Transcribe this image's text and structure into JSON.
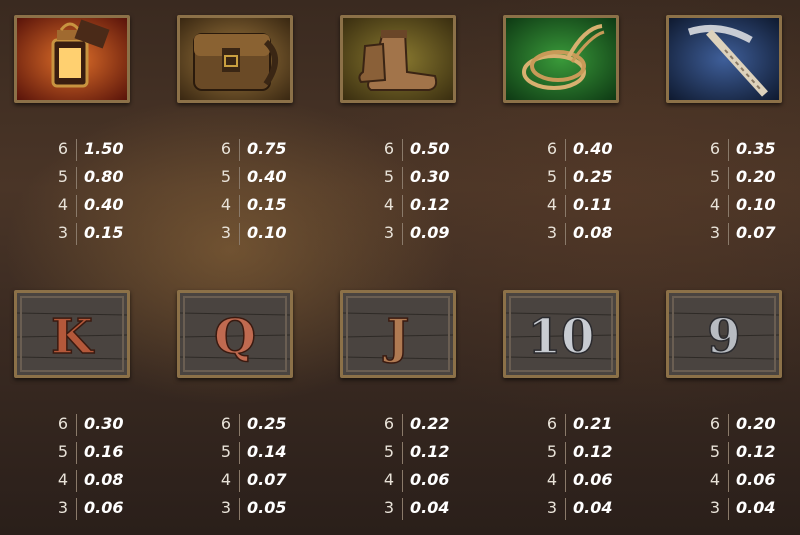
{
  "rows": [
    {
      "symbols": [
        {
          "name": "lantern",
          "icon": "lantern-icon",
          "pays": [
            {
              "count": "6",
              "value": "1.50"
            },
            {
              "count": "5",
              "value": "0.80"
            },
            {
              "count": "4",
              "value": "0.40"
            },
            {
              "count": "3",
              "value": "0.15"
            }
          ]
        },
        {
          "name": "backpack",
          "icon": "backpack-icon",
          "pays": [
            {
              "count": "6",
              "value": "0.75"
            },
            {
              "count": "5",
              "value": "0.40"
            },
            {
              "count": "4",
              "value": "0.15"
            },
            {
              "count": "3",
              "value": "0.10"
            }
          ]
        },
        {
          "name": "boots",
          "icon": "boots-icon",
          "pays": [
            {
              "count": "6",
              "value": "0.50"
            },
            {
              "count": "5",
              "value": "0.30"
            },
            {
              "count": "4",
              "value": "0.12"
            },
            {
              "count": "3",
              "value": "0.09"
            }
          ]
        },
        {
          "name": "rope",
          "icon": "rope-icon",
          "pays": [
            {
              "count": "6",
              "value": "0.40"
            },
            {
              "count": "5",
              "value": "0.25"
            },
            {
              "count": "4",
              "value": "0.11"
            },
            {
              "count": "3",
              "value": "0.08"
            }
          ]
        },
        {
          "name": "pickaxe",
          "icon": "pickaxe-icon",
          "pays": [
            {
              "count": "6",
              "value": "0.35"
            },
            {
              "count": "5",
              "value": "0.20"
            },
            {
              "count": "4",
              "value": "0.10"
            },
            {
              "count": "3",
              "value": "0.07"
            }
          ]
        }
      ]
    },
    {
      "symbols": [
        {
          "name": "K",
          "glyph": "K",
          "pays": [
            {
              "count": "6",
              "value": "0.30"
            },
            {
              "count": "5",
              "value": "0.16"
            },
            {
              "count": "4",
              "value": "0.08"
            },
            {
              "count": "3",
              "value": "0.06"
            }
          ]
        },
        {
          "name": "Q",
          "glyph": "Q",
          "pays": [
            {
              "count": "6",
              "value": "0.25"
            },
            {
              "count": "5",
              "value": "0.14"
            },
            {
              "count": "4",
              "value": "0.07"
            },
            {
              "count": "3",
              "value": "0.05"
            }
          ]
        },
        {
          "name": "J",
          "glyph": "J",
          "pays": [
            {
              "count": "6",
              "value": "0.22"
            },
            {
              "count": "5",
              "value": "0.12"
            },
            {
              "count": "4",
              "value": "0.06"
            },
            {
              "count": "3",
              "value": "0.04"
            }
          ]
        },
        {
          "name": "10",
          "glyph": "10",
          "pays": [
            {
              "count": "6",
              "value": "0.21"
            },
            {
              "count": "5",
              "value": "0.12"
            },
            {
              "count": "4",
              "value": "0.06"
            },
            {
              "count": "3",
              "value": "0.04"
            }
          ]
        },
        {
          "name": "9",
          "glyph": "9",
          "pays": [
            {
              "count": "6",
              "value": "0.20"
            },
            {
              "count": "5",
              "value": "0.12"
            },
            {
              "count": "4",
              "value": "0.06"
            },
            {
              "count": "3",
              "value": "0.04"
            }
          ]
        }
      ]
    }
  ],
  "colors": {
    "frame": "#8c7148",
    "lantern_bg": "#8a2a12",
    "backpack_bg": "#7a5a2a",
    "boots_bg": "#6a5a1a",
    "rope_bg": "#1f6a2a",
    "pickaxe_bg": "#2a3f66",
    "letter_k": "#b4583a",
    "letter_q": "#c06a50",
    "letter_j": "#b07a52",
    "letter_10": "#c8ccd2",
    "letter_9": "#b8bcc2"
  }
}
